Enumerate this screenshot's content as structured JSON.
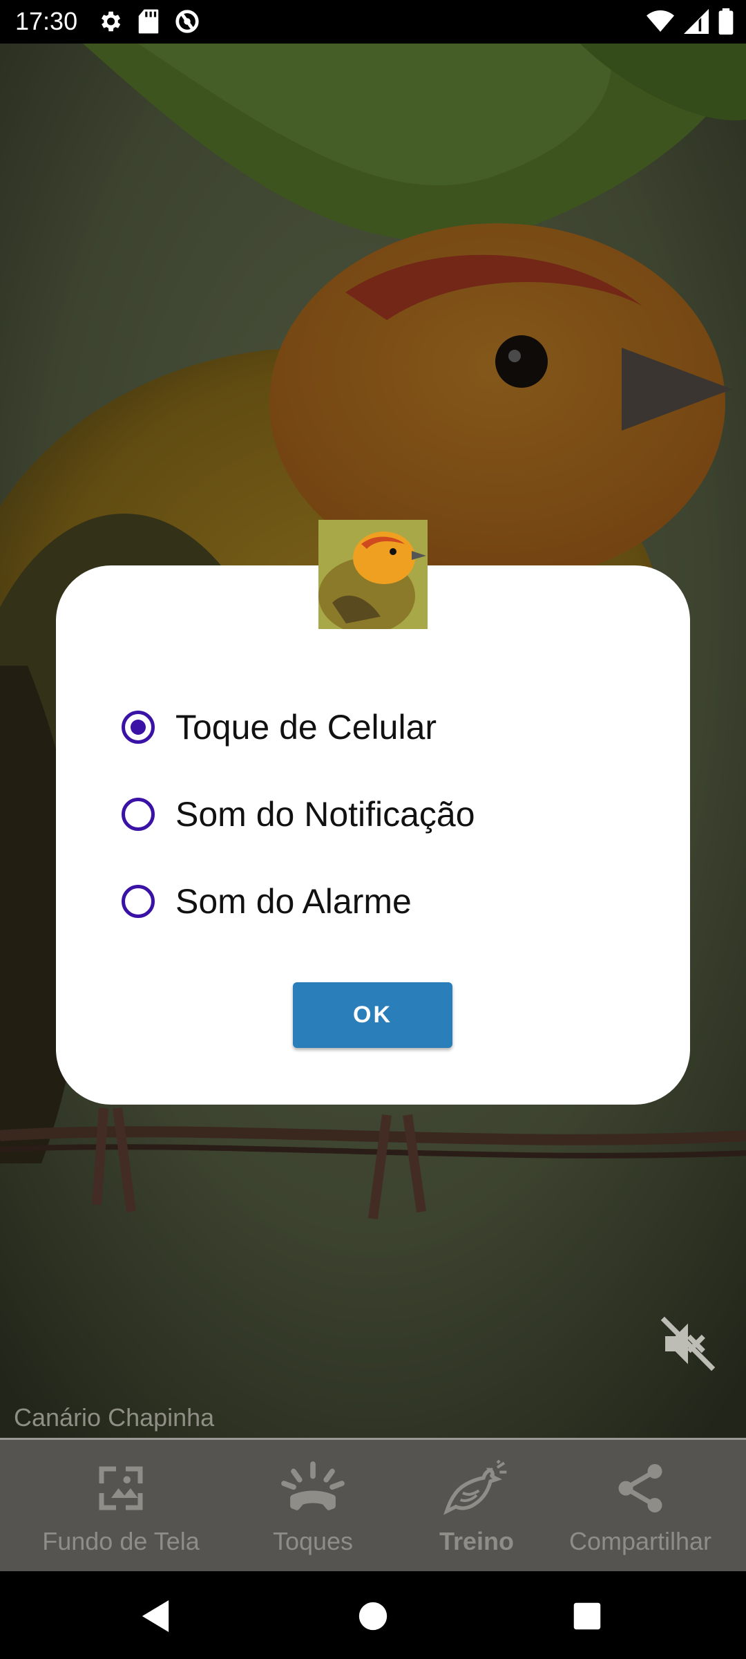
{
  "status_bar": {
    "time": "17:30",
    "left_icons": [
      "settings-icon",
      "sd-card-icon",
      "data-saver-icon"
    ],
    "right_icons": [
      "wifi-icon",
      "cell-signal-icon",
      "battery-icon"
    ]
  },
  "dialog": {
    "options": [
      {
        "label": "Toque de Celular",
        "checked": true
      },
      {
        "label": "Som do Notificação",
        "checked": false
      },
      {
        "label": "Som do Alarme",
        "checked": false
      }
    ],
    "ok_label": "OK"
  },
  "caption": "Canário Chapinha",
  "bottom_nav": {
    "items": [
      {
        "label": "Fundo de Tela",
        "icon": "wallpaper-icon",
        "active": false
      },
      {
        "label": "Toques",
        "icon": "ringtone-icon",
        "active": false
      },
      {
        "label": "Treino",
        "icon": "bird-icon",
        "active": true
      },
      {
        "label": "Compartilhar",
        "icon": "share-icon",
        "active": false
      }
    ]
  },
  "colors": {
    "accent_radio": "#3a12a5",
    "ok_button": "#2a7fba",
    "nav_background": "#555450"
  },
  "system_nav": [
    "back-icon",
    "home-icon",
    "recents-icon"
  ]
}
